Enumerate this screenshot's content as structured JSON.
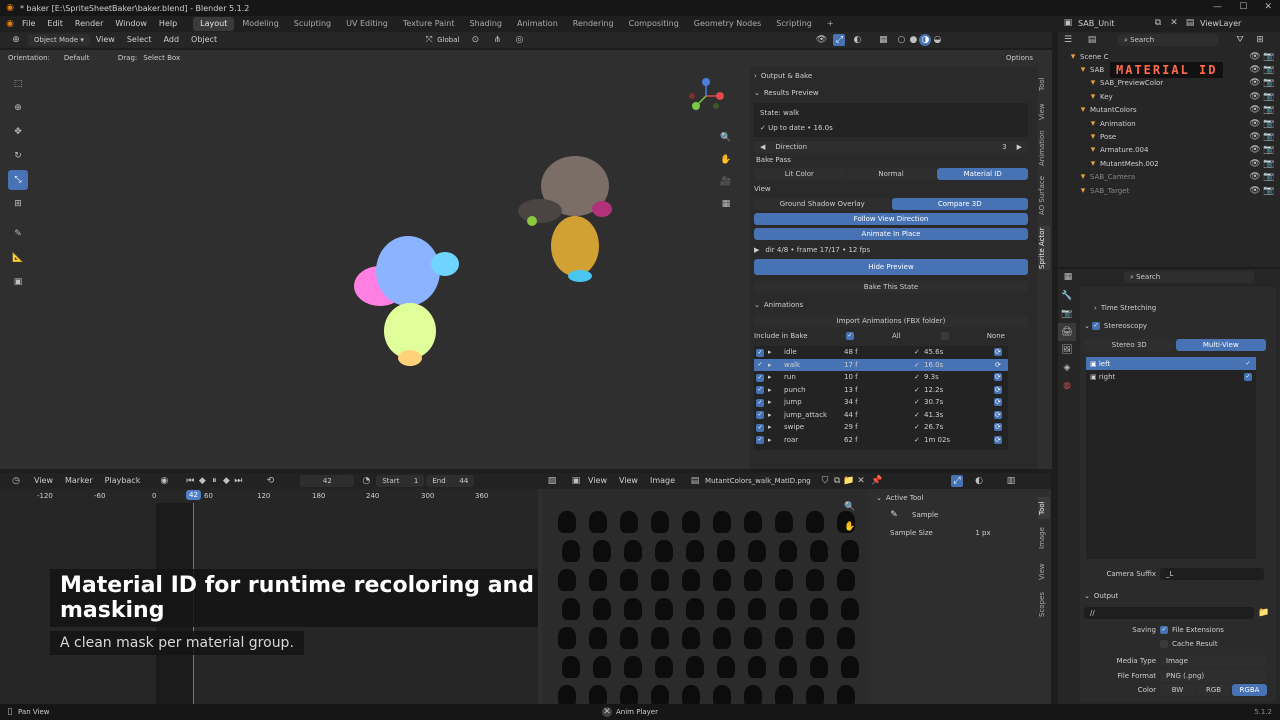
{
  "window": {
    "title": "* baker [E:\\SpriteSheetBaker\\baker.blend] - Blender 5.1.2"
  },
  "menu": [
    "File",
    "Edit",
    "Render",
    "Window",
    "Help"
  ],
  "workspaces": [
    "Layout",
    "Modeling",
    "Sculpting",
    "UV Editing",
    "Texture Paint",
    "Shading",
    "Animation",
    "Rendering",
    "Compositing",
    "Geometry Nodes",
    "Scripting"
  ],
  "scene": {
    "unit": "SAB_Unit",
    "view_layer": "ViewLayer"
  },
  "viewport": {
    "mode": "Object Mode",
    "menus": [
      "View",
      "Select",
      "Add",
      "Object"
    ],
    "transform": "Global",
    "orientation_label": "Orientation:",
    "orientation_value": "Default",
    "drag_label": "Drag:",
    "drag_value": "Select Box",
    "options": "Options"
  },
  "npanel": {
    "output_bake": "Output & Bake",
    "results_preview": "Results Preview",
    "state": "State: walk",
    "uptodate": "Up to date • 16.0s",
    "direction_label": "Direction",
    "direction_value": "3",
    "pass_label": "Bake Pass",
    "passes": [
      "Lit Color",
      "Normal",
      "Material ID"
    ],
    "active_pass": "Material ID",
    "view_label": "View",
    "ground_shadow": "Ground Shadow Overlay",
    "compare3d": "Compare 3D",
    "follow_view": "Follow View Direction",
    "animate_place": "Animate In Place",
    "dir_frame": "dir 4/8  •  frame 17/17  •  12 fps",
    "hide_preview": "Hide Preview",
    "bake_state": "Bake This State",
    "animations": "Animations",
    "import_anims": "Import Animations (FBX folder)",
    "include": "Include in Bake",
    "all": "All",
    "none": "None",
    "tabs": [
      "Tool",
      "View",
      "Animation",
      "AO Surface",
      "Sprite Actor"
    ],
    "anims": [
      {
        "name": "idle",
        "frames": "48 f",
        "dur": "45.6s"
      },
      {
        "name": "walk",
        "frames": "17 f",
        "dur": "16.0s"
      },
      {
        "name": "run",
        "frames": "10 f",
        "dur": "9.3s"
      },
      {
        "name": "punch",
        "frames": "13 f",
        "dur": "12.2s"
      },
      {
        "name": "jump",
        "frames": "34 f",
        "dur": "30.7s"
      },
      {
        "name": "jump_attack",
        "frames": "44 f",
        "dur": "41.3s"
      },
      {
        "name": "swipe",
        "frames": "29 f",
        "dur": "26.7s"
      },
      {
        "name": "roar",
        "frames": "62 f",
        "dur": "1m 02s"
      }
    ]
  },
  "timeline": {
    "menus": [
      "View",
      "Marker",
      "Playback"
    ],
    "current": "42",
    "start_label": "Start",
    "start": "1",
    "end_label": "End",
    "end": "44",
    "ruler": [
      "-120",
      "-60",
      "0",
      "42",
      "60",
      "120",
      "180",
      "240",
      "300",
      "360"
    ]
  },
  "caption": {
    "title": "Material ID for runtime recoloring and masking",
    "subtitle": "A clean mask per material group."
  },
  "image_editor": {
    "menus": [
      "View",
      "View",
      "Image"
    ],
    "file": "MutantColors_walk_MatID.png",
    "active_tool": "Active Tool",
    "sample": "Sample",
    "sample_size_label": "Sample Size",
    "sample_size": "1 px",
    "tabs": [
      "Tool",
      "Image",
      "View",
      "Scopes"
    ]
  },
  "outliner": {
    "search": "Search",
    "overlay": "MATERIAL ID",
    "items": [
      {
        "label": "Scene C",
        "depth": 0
      },
      {
        "label": "SAB",
        "depth": 1
      },
      {
        "label": "SAB_PreviewColor",
        "depth": 2
      },
      {
        "label": "Key",
        "depth": 2
      },
      {
        "label": "MutantColors",
        "depth": 1
      },
      {
        "label": "Animation",
        "depth": 2
      },
      {
        "label": "Pose",
        "depth": 2
      },
      {
        "label": "Armature.004",
        "depth": 2
      },
      {
        "label": "MutantMesh.002",
        "depth": 2
      },
      {
        "label": "SAB_Camera",
        "depth": 1
      },
      {
        "label": "SAB_Target",
        "depth": 1
      }
    ]
  },
  "properties": {
    "search": "Search",
    "time_stretching": "Time Stretching",
    "stereoscopy": "Stereoscopy",
    "stereo3d": "Stereo 3D",
    "multiview": "Multi-View",
    "views": [
      "left",
      "right"
    ],
    "camera_suffix_label": "Camera Suffix",
    "camera_suffix": "_L",
    "output": "Output",
    "path": "//",
    "saving_label": "Saving",
    "file_ext": "File Extensions",
    "cache": "Cache Result",
    "media_type_label": "Media Type",
    "media_type": "Image",
    "file_format_label": "File Format",
    "file_format": "PNG (.png)",
    "color_label": "Color",
    "color_opts": [
      "BW",
      "RGB",
      "RGBA"
    ]
  },
  "status": {
    "left": "Pan View",
    "center": "Anim Player",
    "version": "5.1.2"
  },
  "colors": {
    "accent": "#4772b3",
    "active_frame": "#4f7fc9"
  }
}
